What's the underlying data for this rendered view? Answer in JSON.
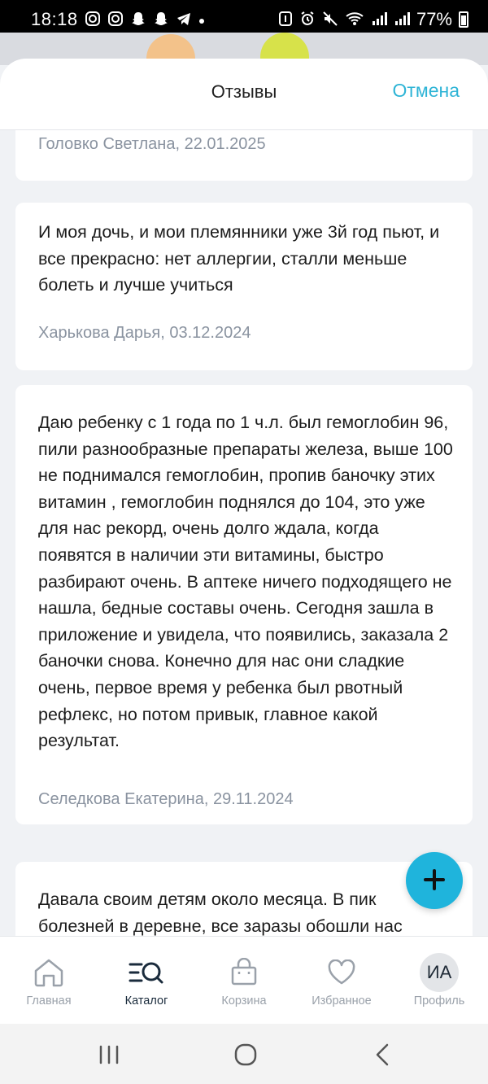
{
  "status_bar": {
    "time": "18:18",
    "battery": "77%"
  },
  "header": {
    "title": "Отзывы",
    "cancel_label": "Отмена"
  },
  "reviews": [
    {
      "text": "",
      "author_date": "Головко Светлана, 22.01.2025"
    },
    {
      "text": "И моя дочь, и мои племянники уже 3й год пьют, и все прекрасно: нет аллергии, сталли меньше болеть и лучше учиться",
      "author_date": "Харькова Дарья, 03.12.2024"
    },
    {
      "text": "Даю ребенку с 1 года по 1 ч.л. был гемоглобин 96, пили разнообразные препараты железа, выше 100 не поднимался гемоглобин, пропив баночку этих витамин , гемоглобин поднялся до 104, это уже для нас рекорд, очень долго ждала, когда появятся в наличии эти витамины, быстро разбирают очень. В аптеке ничего подходящего не нашла, бедные составы очень. Сегодня зашла в приложение и увидела, что появились, заказала 2 баночки снова. Конечно для нас они сладкие очень, первое время у ребенка был рвотный рефлекс, но потом привык, главное какой результат.",
      "author_date": "Селедкова Екатерина, 29.11.2024"
    },
    {
      "text": "Давала своим детям около месяца. В пик болезней в деревне, все заразы обошли нас",
      "author_date": ""
    }
  ],
  "fab": {
    "icon": "plus-icon"
  },
  "bottom_nav": {
    "items": [
      {
        "label": "Главная",
        "icon": "home-icon"
      },
      {
        "label": "Каталог",
        "icon": "catalog-search-icon"
      },
      {
        "label": "Корзина",
        "icon": "bag-icon"
      },
      {
        "label": "Избранное",
        "icon": "heart-icon"
      },
      {
        "label": "Профиль",
        "icon": "avatar"
      }
    ],
    "active": "Каталог",
    "avatar_initials": "ИА"
  },
  "colors": {
    "accent": "#1fb4dc",
    "cancel": "#2eb4d6",
    "meta_text": "#8a93a0",
    "background": "#f0f2f5"
  }
}
